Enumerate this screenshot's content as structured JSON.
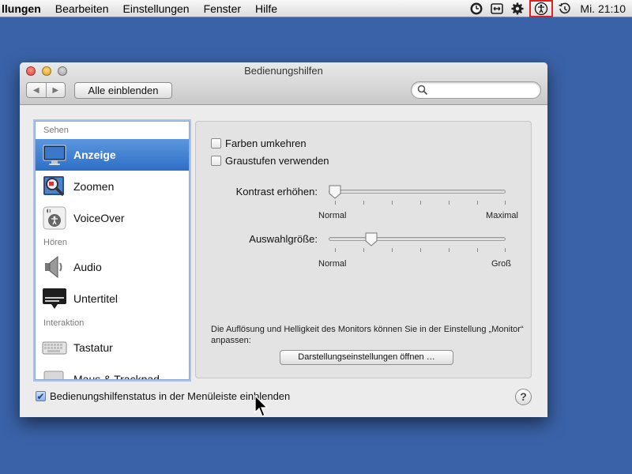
{
  "menubar": {
    "app_menu": "llungen",
    "items": [
      "Bearbeiten",
      "Einstellungen",
      "Fenster",
      "Hilfe"
    ],
    "clock": "Mi. 21:10"
  },
  "window": {
    "title": "Bedienungshilfen",
    "show_all_label": "Alle einblenden",
    "search": {
      "value": "",
      "placeholder": ""
    }
  },
  "sidebar": {
    "section_seeing": "Sehen",
    "item_display": "Anzeige",
    "item_zoom": "Zoomen",
    "item_voiceover": "VoiceOver",
    "section_hearing": "Hören",
    "item_audio": "Audio",
    "item_subtitles": "Untertitel",
    "section_interaction": "Interaktion",
    "item_keyboard": "Tastatur",
    "item_mouse": "Maus & Trackpad",
    "selected": "Anzeige"
  },
  "pane": {
    "invert_colors_label": "Farben umkehren",
    "invert_colors_checked": false,
    "grayscale_label": "Graustufen verwenden",
    "grayscale_checked": false,
    "contrast": {
      "label": "Kontrast erhöhen:",
      "min_label": "Normal",
      "max_label": "Maximal",
      "value": 0.0
    },
    "cursor_size": {
      "label": "Auswahlgröße:",
      "min_label": "Normal",
      "max_label": "Groß",
      "value": 0.22
    },
    "note": "Die Auflösung und Helligkeit des Monitors können Sie in der Einstellung „Monitor“ anpassen:",
    "open_display_button": "Darstellungseinstellungen öffnen …"
  },
  "footer": {
    "show_status_label": "Bedienungshilfenstatus in der Menüleiste einblenden",
    "show_status_checked": true,
    "help_label": "?"
  },
  "colors": {
    "desktop": "#3a62a8",
    "selection": "#2e6ec6",
    "highlight_box": "#e02020"
  }
}
